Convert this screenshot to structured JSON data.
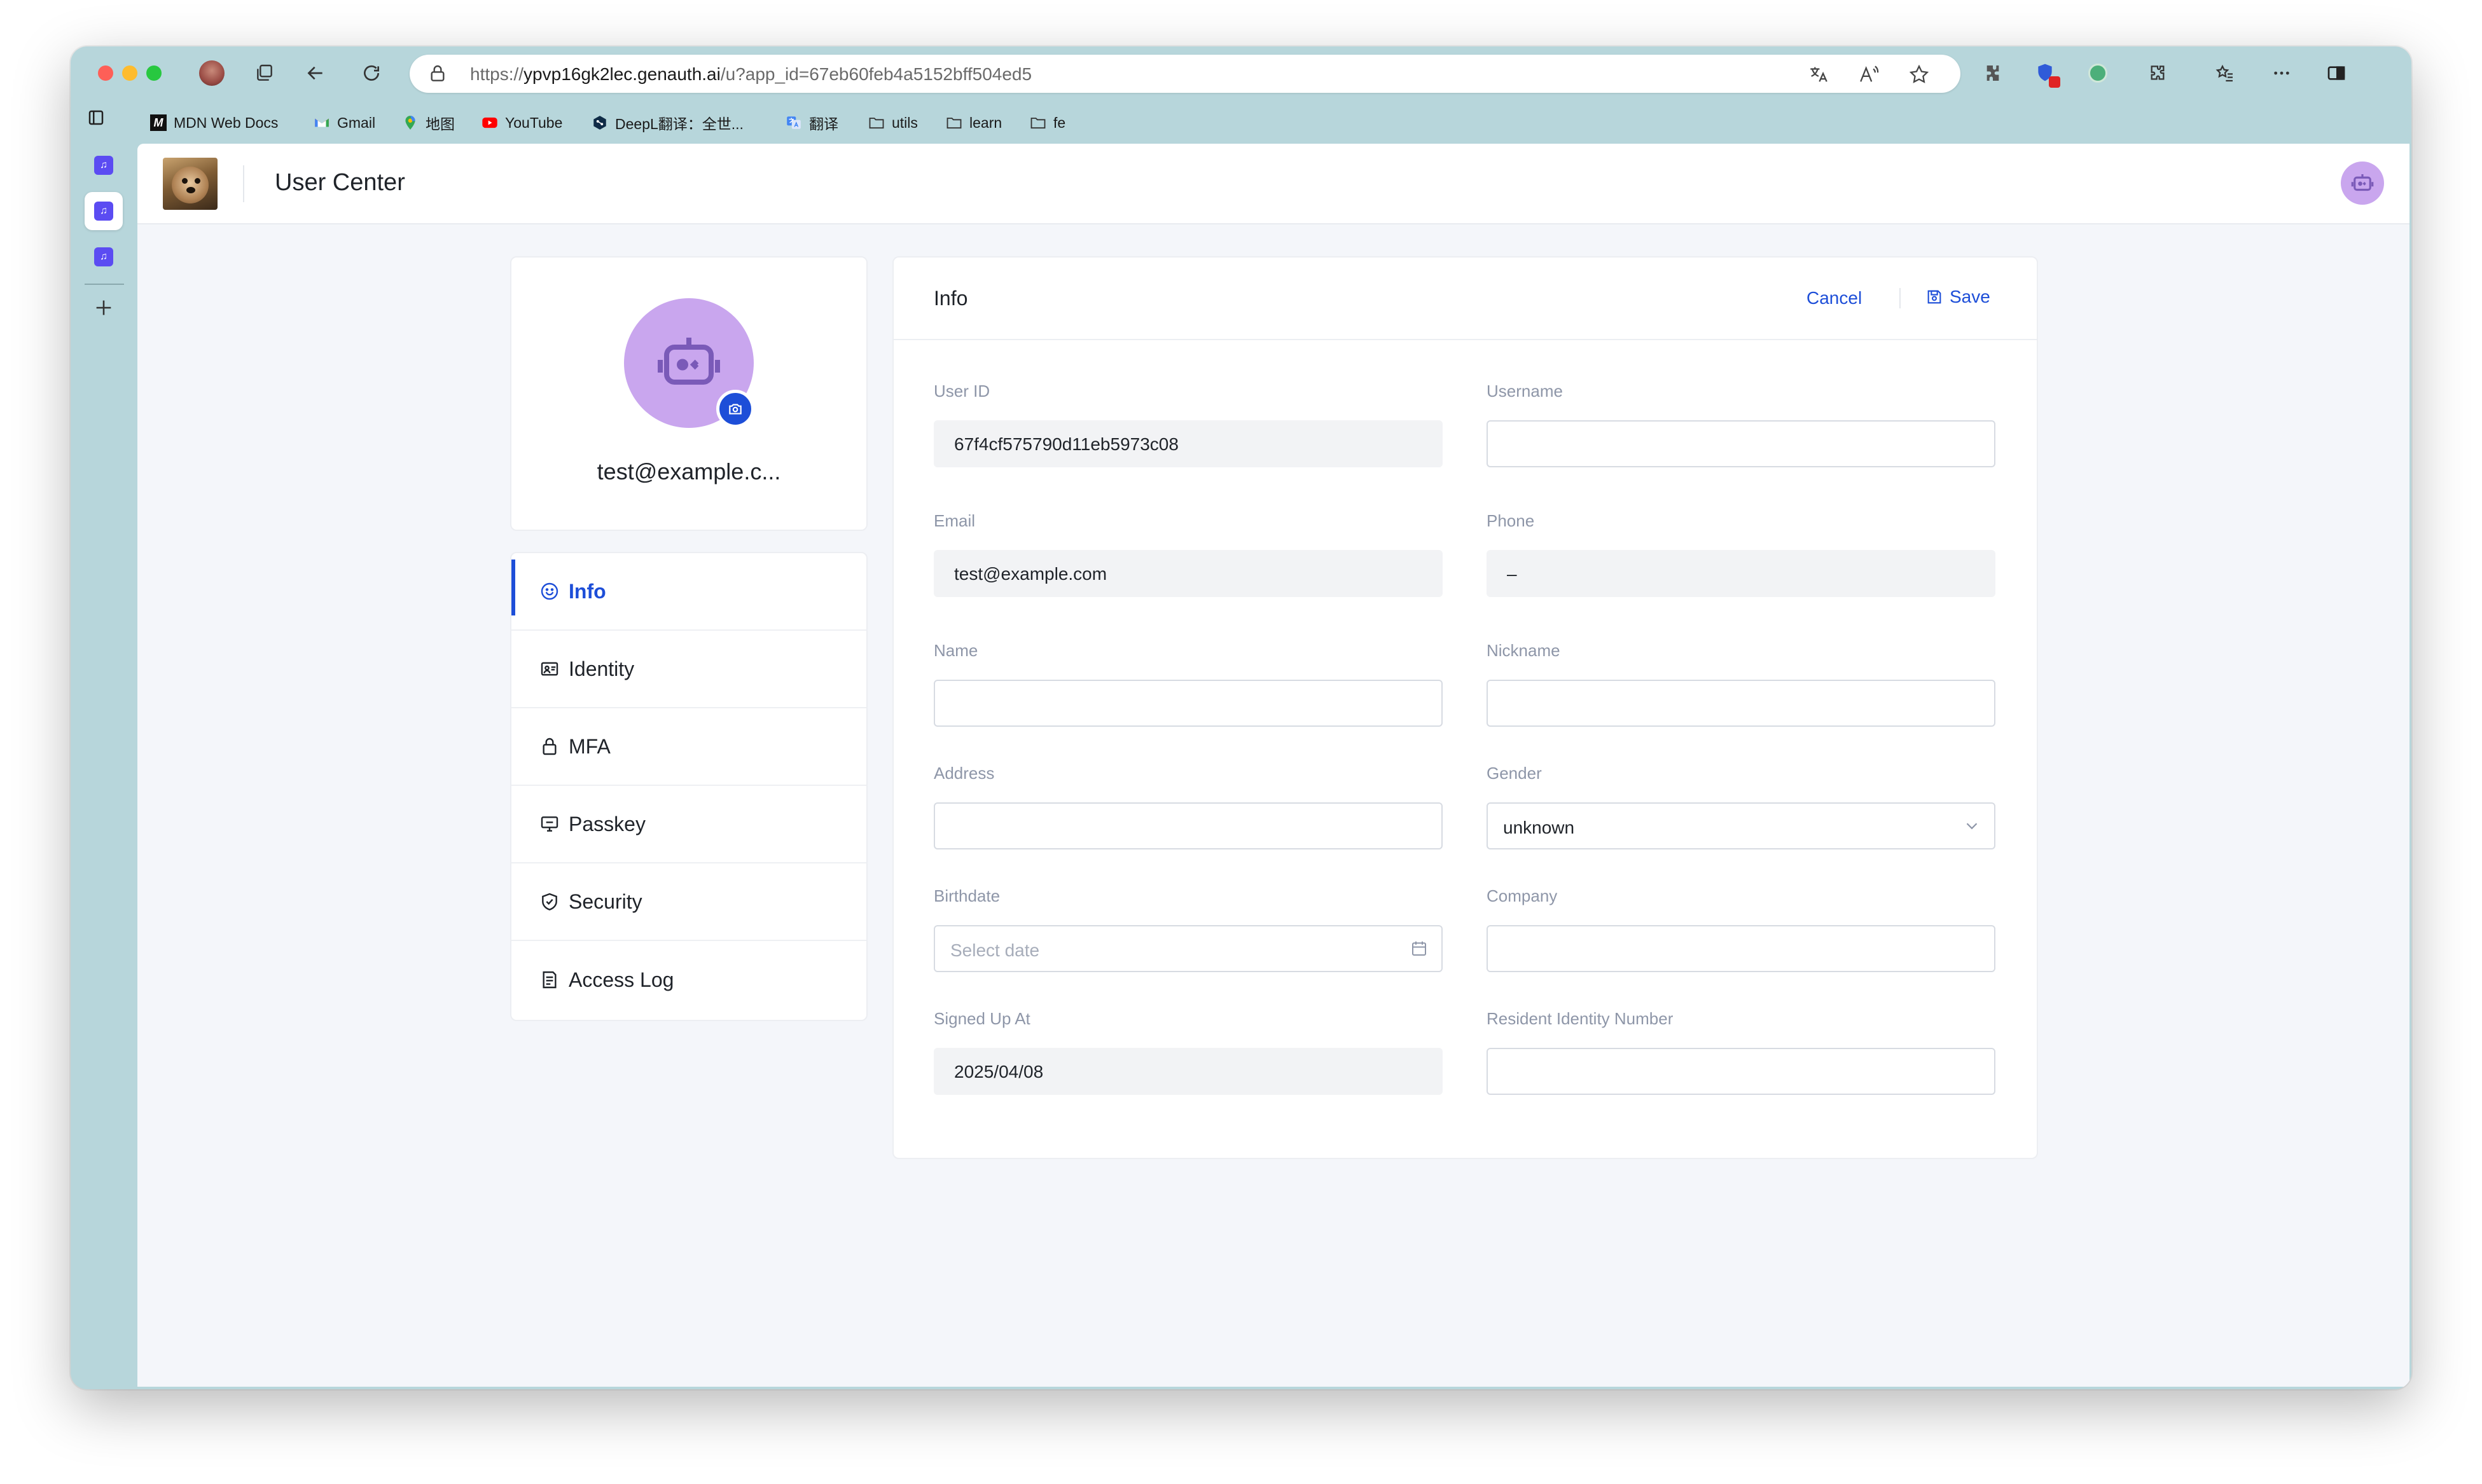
{
  "browser": {
    "url_base": "https://",
    "url_host": "ypvp16gk2lec.genauth.ai",
    "url_path": "/u?app_id=67eb60feb4a5152bff504ed5",
    "bookmarks": [
      {
        "label": "MDN Web Docs",
        "icon": "mdn-icon"
      },
      {
        "label": "Gmail",
        "icon": "gmail-icon"
      },
      {
        "label": "地图",
        "icon": "maps-icon"
      },
      {
        "label": "YouTube",
        "icon": "youtube-icon"
      },
      {
        "label": "DeepL翻译：全世...",
        "icon": "deepl-icon"
      },
      {
        "label": "翻译",
        "icon": "translate-icon"
      },
      {
        "label": "utils",
        "icon": "folder-icon"
      },
      {
        "label": "learn",
        "icon": "folder-icon"
      },
      {
        "label": "fe",
        "icon": "folder-icon"
      }
    ]
  },
  "header": {
    "title": "User Center"
  },
  "profile": {
    "email_display": "test@example.c..."
  },
  "nav": {
    "items": [
      {
        "label": "Info",
        "icon": "smile-icon",
        "active": true
      },
      {
        "label": "Identity",
        "icon": "id-card-icon",
        "active": false
      },
      {
        "label": "MFA",
        "icon": "lock-icon",
        "active": false
      },
      {
        "label": "Passkey",
        "icon": "monitor-icon",
        "active": false
      },
      {
        "label": "Security",
        "icon": "shield-icon",
        "active": false
      },
      {
        "label": "Access Log",
        "icon": "log-icon",
        "active": false
      }
    ]
  },
  "info": {
    "title": "Info",
    "cancel_label": "Cancel",
    "save_label": "Save",
    "fields": {
      "user_id": {
        "label": "User ID",
        "value": "67f4cf575790d11eb5973c08"
      },
      "username": {
        "label": "Username",
        "value": ""
      },
      "email": {
        "label": "Email",
        "value": "test@example.com"
      },
      "phone": {
        "label": "Phone",
        "value": "–"
      },
      "name": {
        "label": "Name",
        "value": ""
      },
      "nickname": {
        "label": "Nickname",
        "value": ""
      },
      "address": {
        "label": "Address",
        "value": ""
      },
      "gender": {
        "label": "Gender",
        "value": "unknown"
      },
      "birthdate": {
        "label": "Birthdate",
        "placeholder": "Select date"
      },
      "company": {
        "label": "Company",
        "value": ""
      },
      "signed_up_at": {
        "label": "Signed Up At",
        "value": "2025/04/08"
      },
      "resident_id": {
        "label": "Resident Identity Number",
        "value": ""
      }
    }
  },
  "colors": {
    "accent": "#1d4ed8",
    "avatar_bg": "#c9a6ee",
    "window_frame": "#b7d6db",
    "page_bg": "#f4f6fa"
  }
}
